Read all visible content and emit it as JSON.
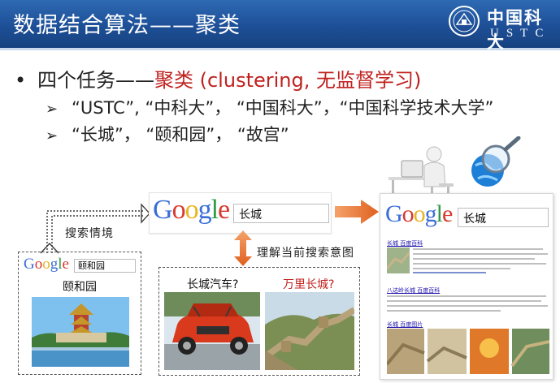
{
  "header": {
    "title": "数据结合算法——聚类",
    "logo_cn": "中国科大",
    "logo_en": "USTC"
  },
  "bullets": {
    "main_prefix": "四个任务——",
    "main_highlight": "聚类 (clustering, 无监督学习)",
    "sub1": "“USTC”, “中科大”，  “中国科大”，“中国科学技术大学”",
    "sub2": "“长城”，  “颐和园”，  “故宫”"
  },
  "labels": {
    "search_context": "搜索情境",
    "understand_intent": "理解当前搜索意图"
  },
  "google": {
    "logo_letters": [
      "G",
      "o",
      "o",
      "g",
      "l",
      "e"
    ],
    "center_query": "长城",
    "left_query": "颐和园",
    "right_query": "长城"
  },
  "left_box": {
    "caption": "颐和园"
  },
  "mid_box": {
    "caption_car": "长城汽车?",
    "caption_wall": "万里长城?"
  },
  "results": {
    "link1": "长城 百度百科",
    "link2": "八达岭长城 百度百科",
    "link3": "长城 百度图片"
  },
  "colors": {
    "header_blue": "#1d4f97",
    "highlight_red": "#c0211f",
    "arrow_orange": "#e36a2b",
    "google_blue": "#3b6fd8",
    "google_red": "#d83a2f",
    "google_yellow": "#e8b520",
    "google_green": "#2f9a48"
  },
  "icons": [
    "ustc-emblem-icon",
    "bullet-arrow-icon",
    "orange-arrow-icon",
    "magnifier-globe-icon",
    "person-desk-icon"
  ]
}
